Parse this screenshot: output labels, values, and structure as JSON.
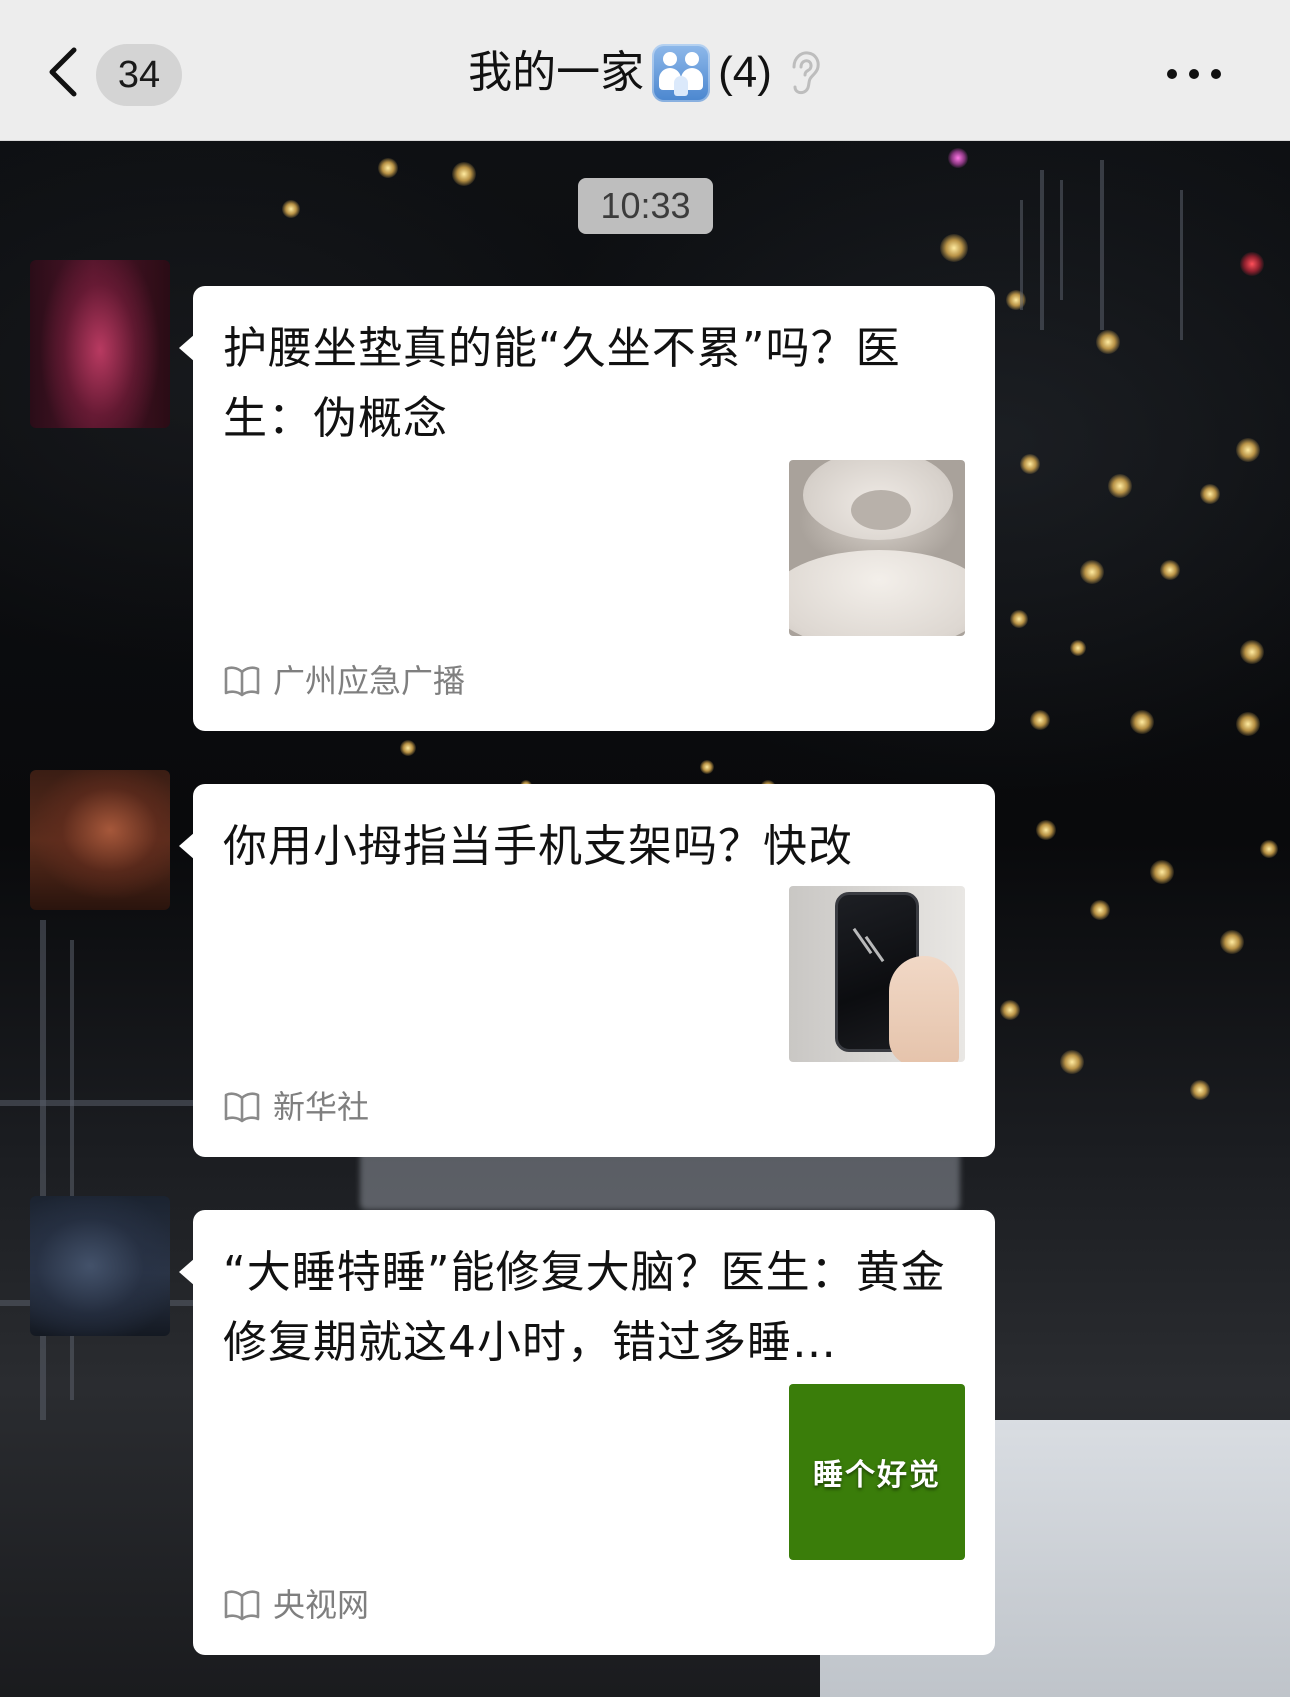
{
  "navbar": {
    "back_icon": "chevron-left-icon",
    "unread_count": "34",
    "title": "我的一家",
    "title_emoji": "family-icon",
    "member_count": "(4)",
    "mute_icon": "ear-icon",
    "more_icon": "more-dots-icon"
  },
  "chat": {
    "timestamp": "10:33",
    "messages": [
      {
        "title": "护腰坐垫真的能“久坐不累”吗？医生：伪概念",
        "source": "广州应急广播",
        "thumbnail": "cushion-photo"
      },
      {
        "title": "你用小拇指当手机支架吗？快改",
        "source": "新华社",
        "thumbnail": "phone-in-hand-photo"
      },
      {
        "title": "“大睡特睡”能修复大脑？医生：黄金修复期就这4小时，错过多睡…",
        "source": "央视网",
        "thumbnail_text": "睡个好觉",
        "thumbnail_color": "#3a7d0a"
      }
    ]
  },
  "colors": {
    "navbar_bg": "#ededed",
    "card_bg": "#ffffff",
    "source_text": "#7f7f7f",
    "badge_bg": "#d4d4d4"
  }
}
